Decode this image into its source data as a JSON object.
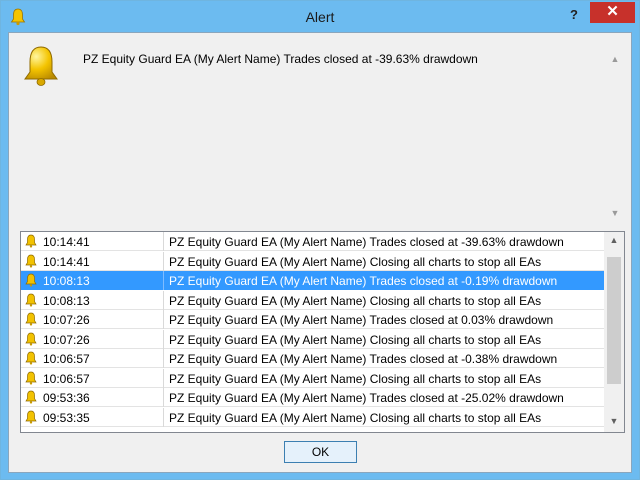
{
  "window": {
    "title": "Alert",
    "help_label": "?",
    "close_label": "✕"
  },
  "message": {
    "text": "PZ Equity Guard EA (My Alert Name) Trades closed at -39.63% drawdown"
  },
  "alerts": [
    {
      "time": "10:14:41",
      "text": "PZ Equity Guard EA (My Alert Name) Trades closed at -39.63% drawdown",
      "selected": false
    },
    {
      "time": "10:14:41",
      "text": "PZ Equity Guard EA (My Alert Name) Closing all charts to stop all EAs",
      "selected": false
    },
    {
      "time": "10:08:13",
      "text": "PZ Equity Guard EA (My Alert Name) Trades closed at -0.19% drawdown",
      "selected": true
    },
    {
      "time": "10:08:13",
      "text": "PZ Equity Guard EA (My Alert Name) Closing all charts to stop all EAs",
      "selected": false
    },
    {
      "time": "10:07:26",
      "text": "PZ Equity Guard EA (My Alert Name) Trades closed at 0.03% drawdown",
      "selected": false
    },
    {
      "time": "10:07:26",
      "text": "PZ Equity Guard EA (My Alert Name) Closing all charts to stop all EAs",
      "selected": false
    },
    {
      "time": "10:06:57",
      "text": "PZ Equity Guard EA (My Alert Name) Trades closed at -0.38% drawdown",
      "selected": false
    },
    {
      "time": "10:06:57",
      "text": "PZ Equity Guard EA (My Alert Name) Closing all charts to stop all EAs",
      "selected": false
    },
    {
      "time": "09:53:36",
      "text": "PZ Equity Guard EA (My Alert Name) Trades closed at -25.02% drawdown",
      "selected": false
    },
    {
      "time": "09:53:35",
      "text": "PZ Equity Guard EA (My Alert Name) Closing all charts to stop all EAs",
      "selected": false
    }
  ],
  "buttons": {
    "ok_label": "OK"
  },
  "icons": {
    "title": "bell-icon",
    "message": "bell-icon",
    "row": "bell-icon"
  },
  "colors": {
    "titlebar": "#6cbbf0",
    "close": "#c7312b",
    "selection": "#3399ff",
    "bell": "#f2c200"
  }
}
